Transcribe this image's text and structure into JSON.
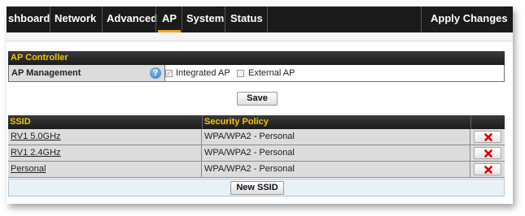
{
  "nav": {
    "tabs": [
      {
        "label": "shboard"
      },
      {
        "label": "Network"
      },
      {
        "label": "Advanced"
      },
      {
        "label": "AP"
      },
      {
        "label": "System"
      },
      {
        "label": "Status"
      }
    ],
    "active_tab": "AP",
    "apply_label": "Apply Changes"
  },
  "ap_controller": {
    "heading": "AP Controller",
    "management_label": "AP Management",
    "help_glyph": "?",
    "integrated_label": "Integrated AP",
    "integrated_checked": true,
    "external_label": "External AP",
    "external_checked": false,
    "save_label": "Save"
  },
  "ssid_table": {
    "columns": [
      "SSID",
      "Security Policy"
    ],
    "rows": [
      {
        "ssid": "RV1 5.0GHz",
        "security": "WPA/WPA2 - Personal"
      },
      {
        "ssid": "RV1 2.4GHz",
        "security": "WPA/WPA2 - Personal"
      },
      {
        "ssid": "Personal",
        "security": "WPA/WPA2 - Personal"
      }
    ],
    "new_label": "New SSID"
  },
  "colors": {
    "nav_bg": "#1b1b1b",
    "active_underline": "#f6a623",
    "header_text": "#f5c400",
    "delete_icon": "#d40000",
    "help_icon": "#2f77c5"
  },
  "icons": {
    "help": "question-circle-icon",
    "delete": "red-x-icon"
  }
}
